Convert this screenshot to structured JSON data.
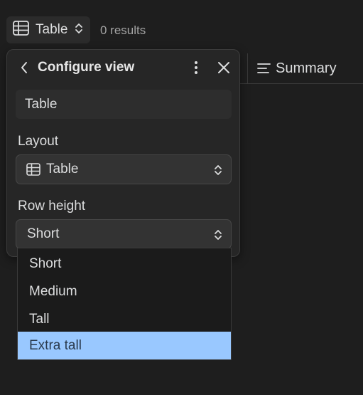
{
  "toolbar": {
    "view_icon": "table-grid-icon",
    "view_label": "Table",
    "results_text": "0 results"
  },
  "column": {
    "icon": "text-lines-icon",
    "label": "Summary"
  },
  "panel": {
    "title": "Configure view",
    "name_value": "Table",
    "layout_label": "Layout",
    "layout_value": "Table",
    "layout_icon": "table-grid-icon",
    "row_height_label": "Row height",
    "row_height_value": "Short"
  },
  "dropdown": {
    "options": [
      "Short",
      "Medium",
      "Tall",
      "Extra tall"
    ],
    "highlighted": "Extra tall",
    "highlight_color": "#99c8ff"
  }
}
